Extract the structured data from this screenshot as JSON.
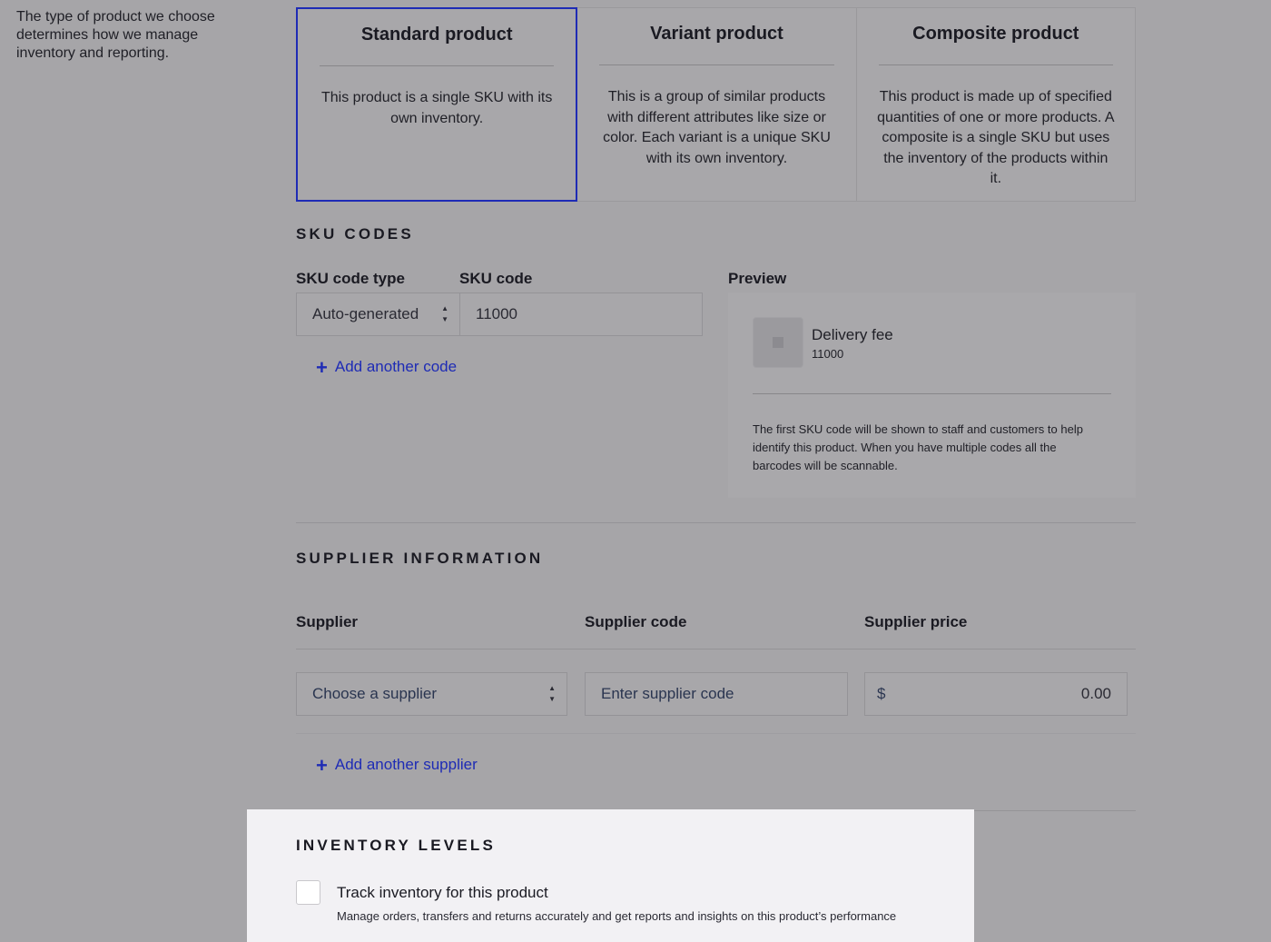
{
  "intro_text": "The type of product we choose determines how we manage inventory and reporting.",
  "product_types": [
    {
      "title": "Standard product",
      "description": "This product is a single SKU with its own inventory.",
      "selected": true
    },
    {
      "title": "Variant product",
      "description": "This is a group of similar products with different attributes like size or color. Each variant is a unique SKU with its own inventory.",
      "selected": false
    },
    {
      "title": "Composite product",
      "description": "This product is made up of specified quantities of one or more products. A composite is a single SKU but uses the inventory of the products within it.",
      "selected": false
    }
  ],
  "sku": {
    "section_title": "SKU CODES",
    "type_label": "SKU code type",
    "code_label": "SKU code",
    "type_value": "Auto-generated",
    "code_value": "11000",
    "add_link": "Add another code",
    "preview_label": "Preview",
    "preview_name": "Delivery fee",
    "preview_code": "11000",
    "preview_note": "The first SKU code will be shown to staff and customers to help identify this product. When you have multiple codes all the barcodes will be scannable."
  },
  "supplier": {
    "section_title": "SUPPLIER INFORMATION",
    "col_supplier": "Supplier",
    "col_code": "Supplier code",
    "col_price": "Supplier price",
    "supplier_placeholder": "Choose a supplier",
    "code_placeholder": "Enter supplier code",
    "currency": "$",
    "price_value": "0.00",
    "add_link": "Add another supplier"
  },
  "inventory": {
    "section_title": "INVENTORY LEVELS",
    "track_label": "Track inventory for this product",
    "track_help": "Manage orders, transfers and returns accurately and get reports and insights on this product’s performance",
    "checked": false
  },
  "colors": {
    "accent": "#1e2bb5",
    "overlay": "#a6a5a8",
    "highlight_panel": "#f2f1f4"
  }
}
